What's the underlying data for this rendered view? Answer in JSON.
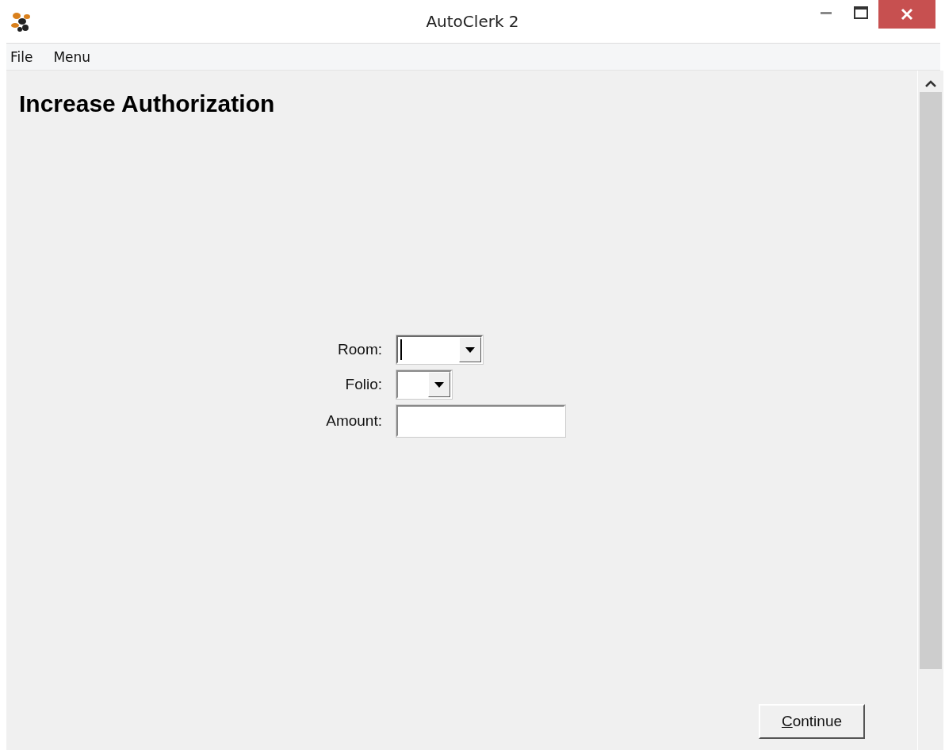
{
  "window": {
    "title": "AutoClerk 2"
  },
  "menu": [
    {
      "label": "File"
    },
    {
      "label": "Menu"
    }
  ],
  "heading": "Increase Authorization",
  "fields": [
    {
      "kind": "combo",
      "label": "Room:",
      "focused": true
    },
    {
      "kind": "combo",
      "label": "Folio:",
      "focused": false
    },
    {
      "kind": "text",
      "label": "Amount:"
    }
  ],
  "continue_button": {
    "label": "Continue"
  }
}
